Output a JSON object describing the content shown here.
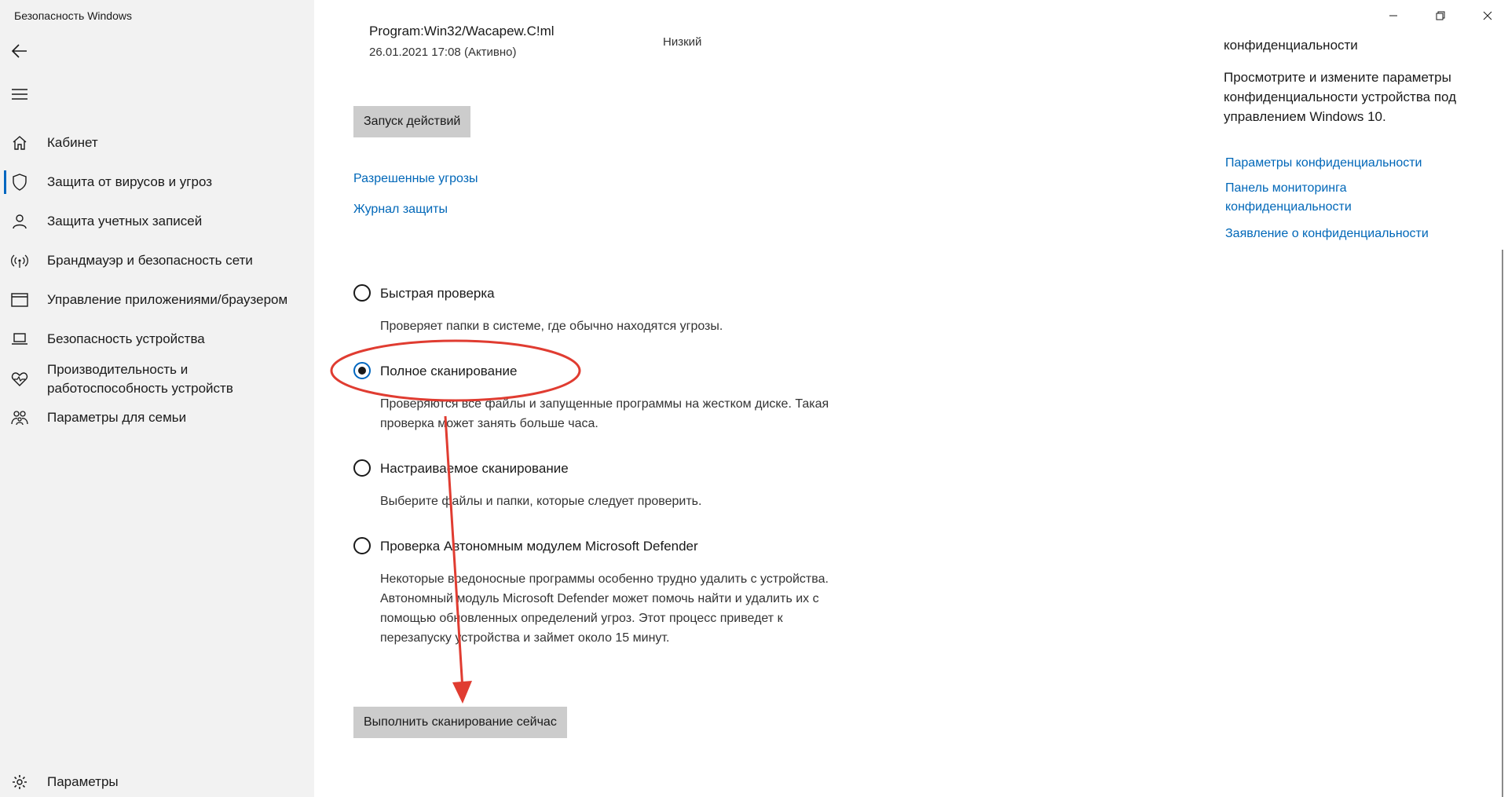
{
  "window": {
    "title": "Безопасность Windows"
  },
  "sidebar": {
    "items": [
      {
        "label": "Кабинет",
        "icon": "home-icon"
      },
      {
        "label": "Защита от вирусов и угроз",
        "icon": "shield-icon",
        "active": true
      },
      {
        "label": "Защита учетных записей",
        "icon": "person-icon"
      },
      {
        "label": "Брандмауэр и безопасность сети",
        "icon": "wifi-icon"
      },
      {
        "label": "Управление приложениями/браузером",
        "icon": "app-window-icon"
      },
      {
        "label": "Безопасность устройства",
        "icon": "laptop-icon"
      },
      {
        "label": "Производительность и работоспособность устройств",
        "icon": "heart-pulse-icon"
      },
      {
        "label": "Параметры для семьи",
        "icon": "family-icon"
      }
    ],
    "settings_label": "Параметры"
  },
  "threat": {
    "name": "Program:Win32/Wacapew.C!ml",
    "date": "26.01.2021 17:08 (Активно)",
    "level": "Низкий"
  },
  "actions": {
    "start_actions_label": "Запуск действий",
    "allowed_threats_link": "Разрешенные угрозы",
    "protection_history_link": "Журнал защиты"
  },
  "scan_options": [
    {
      "label": "Быстрая проверка",
      "desc": "Проверяет папки в системе, где обычно находятся угрозы.",
      "checked": false
    },
    {
      "label": "Полное сканирование",
      "desc": "Проверяются все файлы и запущенные программы на жестком диске. Такая проверка может занять больше часа.",
      "checked": true
    },
    {
      "label": "Настраиваемое сканирование",
      "desc": "Выберите файлы и папки, которые следует проверить.",
      "checked": false
    },
    {
      "label": "Проверка Автономным модулем Microsoft Defender",
      "desc": "Некоторые вредоносные программы особенно трудно удалить с устройства. Автономный модуль Microsoft Defender может помочь найти и удалить их с помощью обновленных определений угроз. Этот процесс приведет к перезапуску устройства и займет около 15 минут.",
      "checked": false
    }
  ],
  "scan_now_label": "Выполнить сканирование сейчас",
  "privacy_panel": {
    "heading": "конфиденциальности",
    "desc": "Просмотрите и измените параметры конфиденциальности устройства под управлением Windows 10.",
    "links": [
      "Параметры конфиденциальности",
      "Панель мониторинга конфиденциальности",
      "Заявление о конфиденциальности"
    ]
  },
  "colors": {
    "accent": "#0067c0",
    "link": "#0067b8",
    "annotation": "#e03c31",
    "sidebar_bg": "#f2f2f2"
  }
}
